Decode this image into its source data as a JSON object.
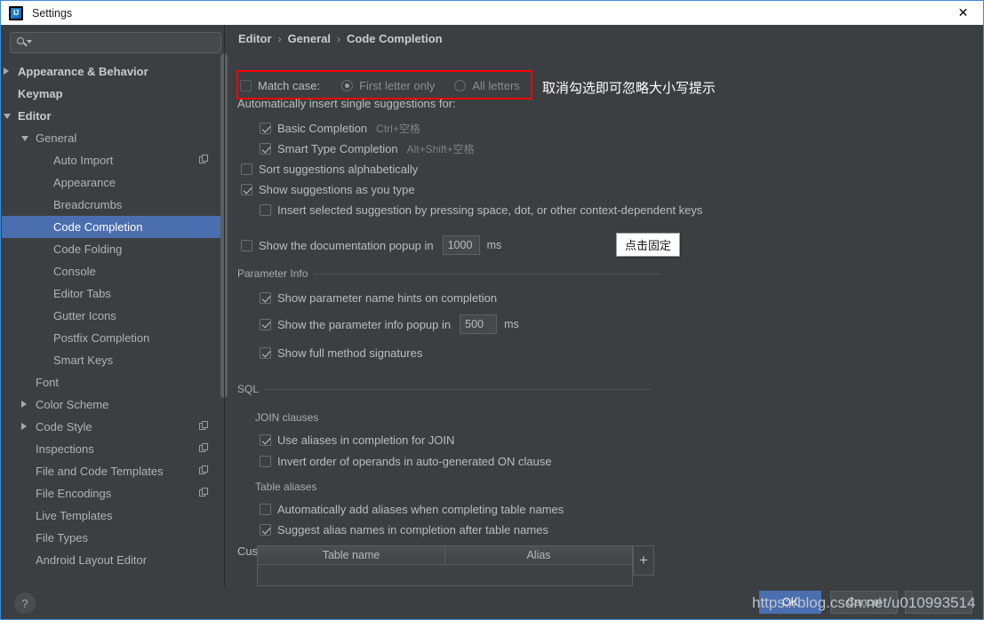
{
  "window": {
    "title": "Settings",
    "logo_icon": "intellij-idea-logo",
    "close_icon": "close-icon"
  },
  "sidebar": {
    "search": {
      "placeholder": "",
      "value": "",
      "icon": "search-icon",
      "dropdown_icon": "chevron-down-icon"
    },
    "items": [
      {
        "label": "Appearance & Behavior",
        "indent": 0,
        "arrow": "right",
        "bold": true,
        "copy": false,
        "selected": false
      },
      {
        "label": "Keymap",
        "indent": 0,
        "arrow": "none",
        "bold": true,
        "copy": false,
        "selected": false
      },
      {
        "label": "Editor",
        "indent": 0,
        "arrow": "down",
        "bold": true,
        "copy": false,
        "selected": false
      },
      {
        "label": "General",
        "indent": 1,
        "arrow": "down",
        "bold": false,
        "copy": false,
        "selected": false
      },
      {
        "label": "Auto Import",
        "indent": 2,
        "arrow": "none",
        "bold": false,
        "copy": true,
        "selected": false
      },
      {
        "label": "Appearance",
        "indent": 2,
        "arrow": "none",
        "bold": false,
        "copy": false,
        "selected": false
      },
      {
        "label": "Breadcrumbs",
        "indent": 2,
        "arrow": "none",
        "bold": false,
        "copy": false,
        "selected": false
      },
      {
        "label": "Code Completion",
        "indent": 2,
        "arrow": "none",
        "bold": false,
        "copy": false,
        "selected": true
      },
      {
        "label": "Code Folding",
        "indent": 2,
        "arrow": "none",
        "bold": false,
        "copy": false,
        "selected": false
      },
      {
        "label": "Console",
        "indent": 2,
        "arrow": "none",
        "bold": false,
        "copy": false,
        "selected": false
      },
      {
        "label": "Editor Tabs",
        "indent": 2,
        "arrow": "none",
        "bold": false,
        "copy": false,
        "selected": false
      },
      {
        "label": "Gutter Icons",
        "indent": 2,
        "arrow": "none",
        "bold": false,
        "copy": false,
        "selected": false
      },
      {
        "label": "Postfix Completion",
        "indent": 2,
        "arrow": "none",
        "bold": false,
        "copy": false,
        "selected": false
      },
      {
        "label": "Smart Keys",
        "indent": 2,
        "arrow": "none",
        "bold": false,
        "copy": false,
        "selected": false
      },
      {
        "label": "Font",
        "indent": 1,
        "arrow": "none",
        "bold": false,
        "copy": false,
        "selected": false
      },
      {
        "label": "Color Scheme",
        "indent": 1,
        "arrow": "right",
        "bold": false,
        "copy": false,
        "selected": false
      },
      {
        "label": "Code Style",
        "indent": 1,
        "arrow": "right",
        "bold": false,
        "copy": true,
        "selected": false
      },
      {
        "label": "Inspections",
        "indent": 1,
        "arrow": "none",
        "bold": false,
        "copy": true,
        "selected": false
      },
      {
        "label": "File and Code Templates",
        "indent": 1,
        "arrow": "none",
        "bold": false,
        "copy": true,
        "selected": false
      },
      {
        "label": "File Encodings",
        "indent": 1,
        "arrow": "none",
        "bold": false,
        "copy": true,
        "selected": false
      },
      {
        "label": "Live Templates",
        "indent": 1,
        "arrow": "none",
        "bold": false,
        "copy": false,
        "selected": false
      },
      {
        "label": "File Types",
        "indent": 1,
        "arrow": "none",
        "bold": false,
        "copy": false,
        "selected": false
      },
      {
        "label": "Android Layout Editor",
        "indent": 1,
        "arrow": "none",
        "bold": false,
        "copy": false,
        "selected": false
      }
    ]
  },
  "breadcrumb": {
    "part1": "Editor",
    "sep1": "›",
    "part2": "General",
    "sep2": "›",
    "part3": "Code Completion"
  },
  "match_case": {
    "checkbox_label": "Match case:",
    "checked": false,
    "radio_first": "First letter only",
    "radio_all": "All letters",
    "selected_radio": "First letter only",
    "highlight_color": "#ff0000"
  },
  "annotation": {
    "text": "取消勾选即可忽略大小写提示"
  },
  "tooltip": {
    "text": "点击固定"
  },
  "auto_insert": {
    "header": "Automatically insert single suggestions for:",
    "items": [
      {
        "label": "Basic Completion",
        "shortcut": "Ctrl+空格",
        "checked": true
      },
      {
        "label": "Smart Type Completion",
        "shortcut": "Alt+Shift+空格",
        "checked": true
      }
    ]
  },
  "completion_options": [
    {
      "label": "Sort suggestions alphabetically",
      "checked": false
    },
    {
      "label": "Show suggestions as you type",
      "checked": true
    },
    {
      "label": "Insert selected suggestion by pressing space, dot, or other context-dependent keys",
      "checked": false
    }
  ],
  "doc_popup": {
    "label": "Show the documentation popup in",
    "checked": false,
    "value": "1000",
    "unit": "ms"
  },
  "parameter_info": {
    "section": "Parameter Info",
    "items": [
      {
        "label": "Show parameter name hints on completion",
        "checked": true
      },
      {
        "label": "Show the parameter info popup in",
        "checked": true,
        "value": "500",
        "unit": "ms"
      },
      {
        "label": "Show full method signatures",
        "checked": true
      }
    ]
  },
  "sql": {
    "section": "SQL",
    "join_header": "JOIN clauses",
    "join_items": [
      {
        "label": "Use aliases in completion for JOIN",
        "checked": true
      },
      {
        "label": "Invert order of operands in auto-generated ON clause",
        "checked": false
      }
    ],
    "alias_header": "Table aliases",
    "alias_items": [
      {
        "label": "Automatically add aliases when completing table names",
        "checked": false
      },
      {
        "label": "Suggest alias names in completion after table names",
        "checked": true
      }
    ],
    "custom_label": "Custom aliases:",
    "table": {
      "columns": [
        "Table name",
        "Alias"
      ],
      "rows": [],
      "add_button": "+"
    }
  },
  "bottom": {
    "help": "?",
    "ok": "OK",
    "cancel": "Cancel",
    "apply": ""
  },
  "watermark": {
    "text": "https://blog.csdn.net/u010993514"
  }
}
